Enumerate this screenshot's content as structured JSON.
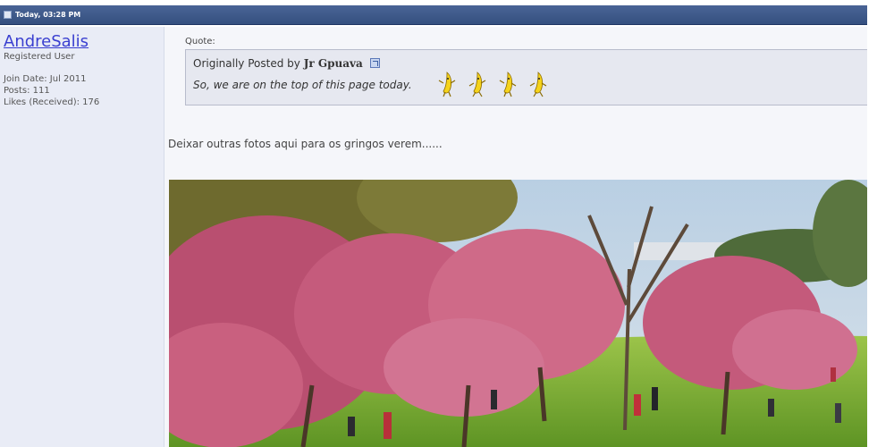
{
  "post": {
    "date": "Today, 03:28 PM"
  },
  "user": {
    "name": "AndreSalis",
    "title": "Registered User",
    "join_date": "Join Date: Jul 2011",
    "posts": "Posts: 111",
    "likes": "Likes (Received): 176"
  },
  "quote": {
    "label": "Quote:",
    "originally_posted_by": "Originally Posted by",
    "author": "Jr Gpuava",
    "text": "So, we are on the top of this page today."
  },
  "message": {
    "text": "Deixar outras fotos aqui para os gringos verem......"
  },
  "colors": {
    "header_bar": "#3d5788",
    "username_link": "#3a3fd0",
    "blossom": "#c8587a",
    "grass": "#7fb236"
  }
}
